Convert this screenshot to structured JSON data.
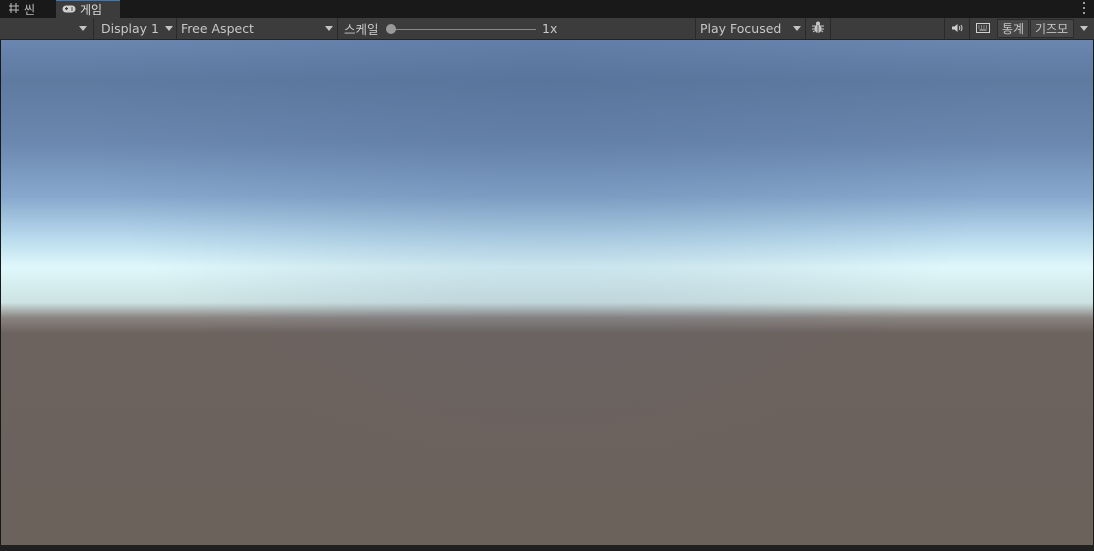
{
  "tabs": [
    {
      "label": "씬",
      "icon": "grid-icon",
      "active": false
    },
    {
      "label": "게임",
      "icon": "gamepad-icon",
      "active": true
    }
  ],
  "toolbar": {
    "display_label": "Display 1",
    "aspect_label": "Free Aspect",
    "scale_label": "스케일",
    "scale_value": "1x",
    "scale_fraction": 0.0,
    "play_mode_label": "Play Focused",
    "stats_label": "통계",
    "gizmos_label": "기즈모"
  },
  "colors": {
    "accent": "#3a79bb",
    "panel": "#3c3c3c",
    "sky_top": "#5f7a9f",
    "horizon": "#dff8fb",
    "ground": "#6c625c"
  }
}
